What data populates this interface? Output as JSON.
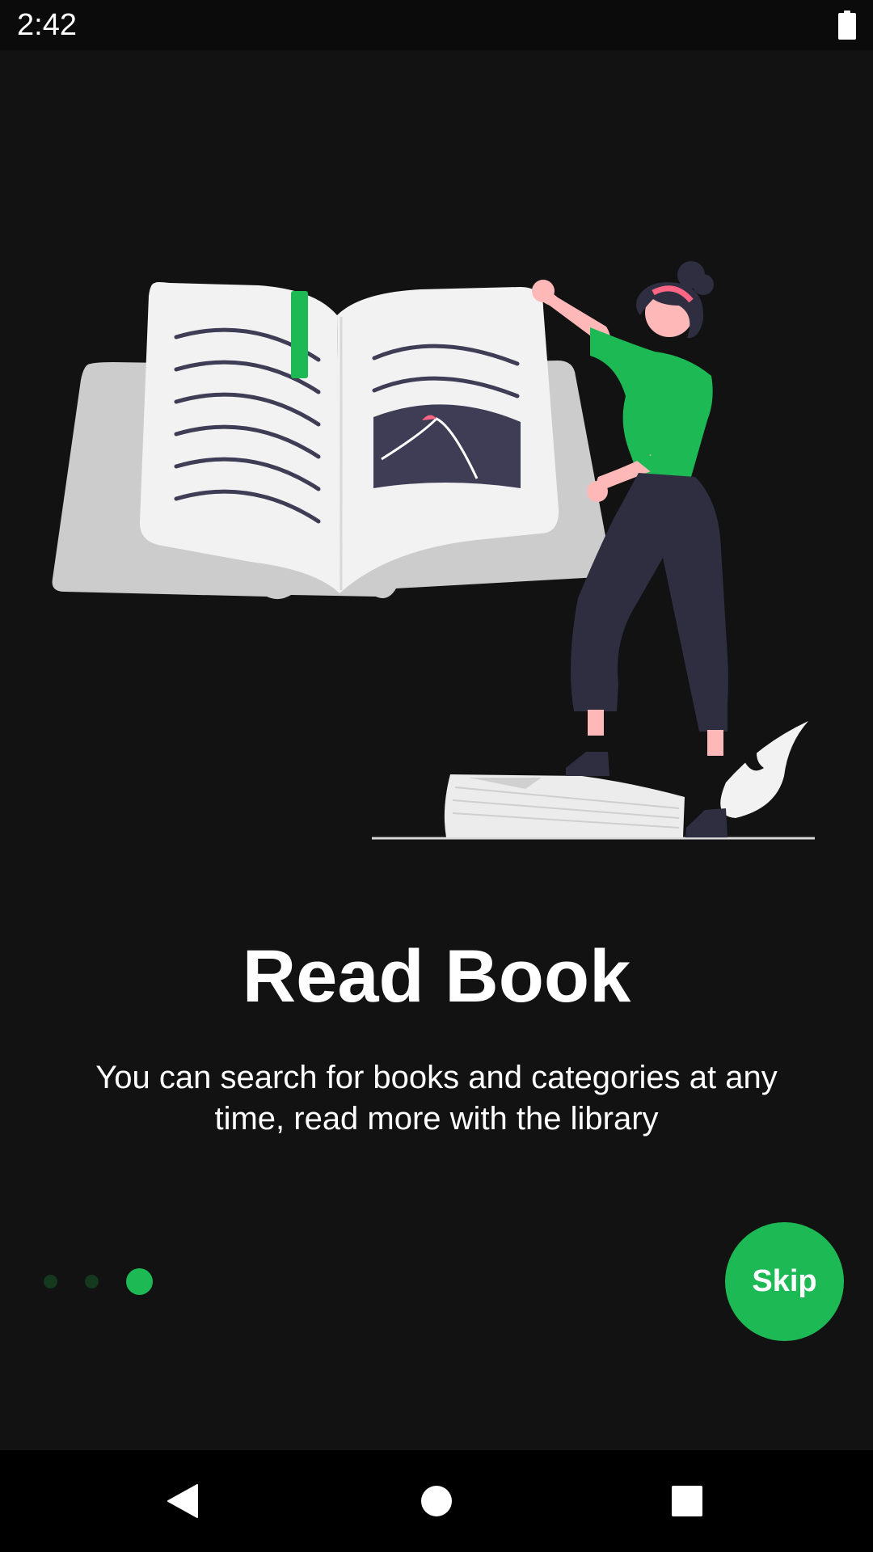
{
  "status_bar": {
    "time": "2:42",
    "battery_icon": "battery-full-icon"
  },
  "onboarding": {
    "title": "Read Book",
    "description": "You can search for books and categories at any time, read more with the library",
    "skip_label": "Skip",
    "page_count": 3,
    "current_page": 3
  },
  "nav_bar": {
    "back_icon": "back-triangle-icon",
    "home_icon": "home-circle-icon",
    "recents_icon": "recents-square-icon"
  },
  "colors": {
    "background": "#121212",
    "accent": "#1DB954",
    "dot_inactive": "#14391f",
    "text": "#FFFFFF",
    "navbar": "#000000",
    "statusbar": "#0b0b0b"
  }
}
